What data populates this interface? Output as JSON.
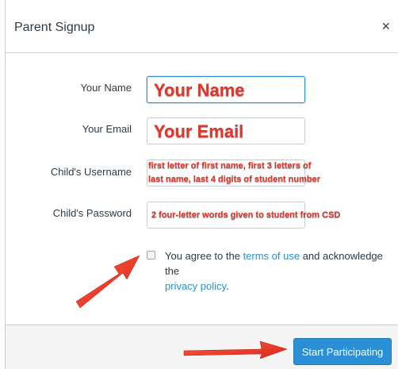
{
  "dialog": {
    "title": "Parent Signup",
    "close_glyph": "×"
  },
  "form": {
    "name_label": "Your Name",
    "email_label": "Your Email",
    "username_label": "Child's Username",
    "password_label": "Child's Password"
  },
  "annotations": {
    "name_note": "Your Name",
    "email_note": "Your Email",
    "username_note_line1": "first letter of first name, first 3 letters of",
    "username_note_line2": "last name, last 4 digits of student number",
    "password_note": "2 four-letter words given to student from CSD"
  },
  "agreement": {
    "prefix": "You agree to the ",
    "terms_link": "terms of use",
    "middle": " and acknowledge the",
    "privacy_link": "privacy policy",
    "suffix": "."
  },
  "footer": {
    "start_label": "Start Participating"
  },
  "colors": {
    "accent": "#2b8fd6",
    "annotation_red": "#e0352b"
  }
}
